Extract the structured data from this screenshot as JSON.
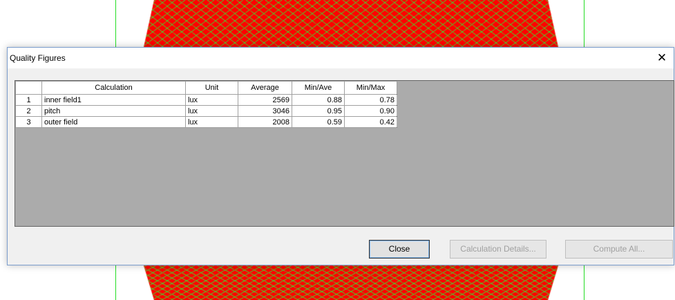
{
  "dialog": {
    "title": "Quality Figures",
    "close_glyph": "✕"
  },
  "table": {
    "headers": [
      "",
      "Calculation",
      "Unit",
      "Average",
      "Min/Ave",
      "Min/Max"
    ],
    "rows": [
      {
        "no": "1",
        "calculation": "inner field1",
        "unit": "lux",
        "average": "2569",
        "min_ave": "0.88",
        "min_max": "0.78"
      },
      {
        "no": "2",
        "calculation": "pitch",
        "unit": "lux",
        "average": "3046",
        "min_ave": "0.95",
        "min_max": "0.90"
      },
      {
        "no": "3",
        "calculation": "outer field",
        "unit": "lux",
        "average": "2008",
        "min_ave": "0.59",
        "min_max": "0.42"
      }
    ]
  },
  "buttons": {
    "close": "Close",
    "calculation_details": "Calculation Details...",
    "compute_all": "Compute All..."
  },
  "colors": {
    "pattern_red": "#ff0000",
    "pattern_green": "#33ee33"
  }
}
